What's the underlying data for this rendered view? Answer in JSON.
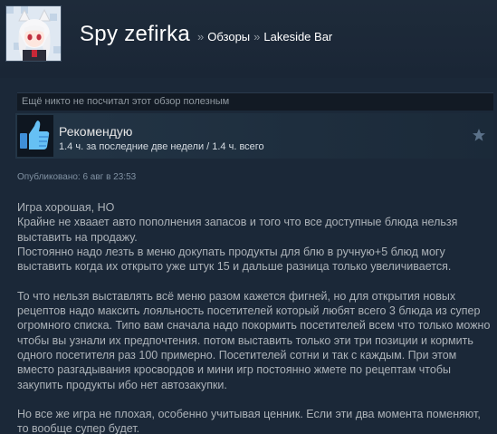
{
  "header": {
    "username": "Spy zefirka",
    "breadcrumb_sep": "»",
    "breadcrumb": [
      "Обзоры",
      "Lakeside Bar"
    ]
  },
  "review": {
    "helpful_text": "Ещё никто не посчитал этот обзор полезным",
    "recommendation": "Рекомендую",
    "hours": "1.4 ч. за последние две недели / 1.4 ч. всего",
    "posted": "Опубликовано: 6 авг в 23:53",
    "paragraphs": [
      "Игра хорошая, НО\nКрайне не хваает авто пополнения запасов и того что все доступные блюда нельзя выставить на продажу.\nПостоянно надо лезть в меню докупать продукты для блю в ручную+5 блюд могу выставить когда их открыто уже штук 15 и дальше разница только увеличивается.",
      "То что нельзя выставлять всё меню разом кажется фигней, но для открытия новых рецептов надо максить лояльность посетителей который любят всего 3 блюда из супер огромного списка. Типо вам сначала надо покормить посетителей всем что только можно чтобы вы узнали их предпочтения. потом выставить только эти три позиции и кормить одного посетителя раз 100 примерно. Посетителей сотни и так с каждым. При этом вместо разгадывания кросвордов и мини игр постоянно жмете по рецептам чтобы закупить продукты ибо нет автозакупки.",
      "Но все же игра не плохая, особенно учитывая ценник. Если эти два момента поменяют, то вообще супер будет."
    ]
  },
  "icons": {
    "avatar": "anime-avatar",
    "thumb": "thumbs-up-icon",
    "award": "star-icon"
  },
  "colors": {
    "background": "#1b2838",
    "thumb_blue": "#66c0f4",
    "text": "#acb2b8"
  }
}
